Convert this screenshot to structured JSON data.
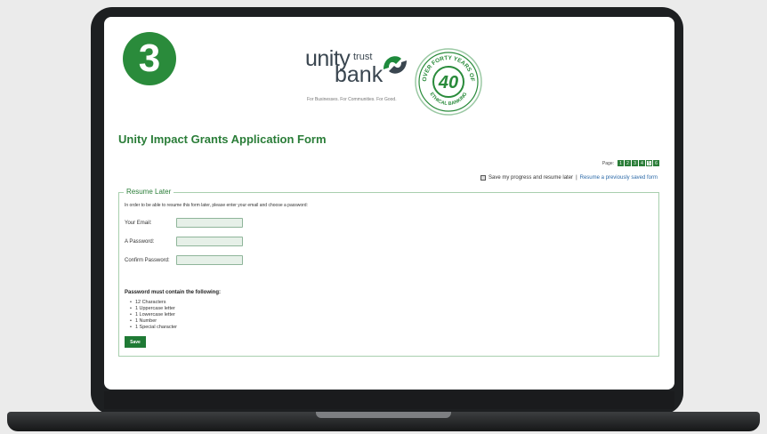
{
  "step": {
    "number": "3"
  },
  "logo": {
    "unity": "unity",
    "trust": "trust",
    "bank": "bank",
    "tagline": "For Businesses. For Communities. For Good.",
    "seal_top": "OVER FORTY YEARS OF",
    "seal_number": "40",
    "seal_bottom": "ETHICAL BANKING"
  },
  "page_title": "Unity Impact Grants Application Form",
  "pager": {
    "label": "Page:",
    "pages": [
      "1",
      "2",
      "3",
      "4",
      "5",
      "6"
    ],
    "current_page": "5"
  },
  "save_progress": {
    "checkbox_label": "Save my progress and resume later",
    "separator": "|",
    "resume_link": "Resume a previously saved form"
  },
  "resume_form": {
    "legend": "Resume Later",
    "instructions": "In order to be able to resume this form later, please enter your email and choose a password:",
    "email_label": "Your Email:",
    "password_label": "A Password:",
    "confirm_label": "Confirm Password:",
    "email_value": "",
    "password_value": "",
    "confirm_value": "",
    "password_rules_title": "Password must contain the following:",
    "password_rules": [
      "12 Characters",
      "1 Uppercase letter",
      "1 Lowercase letter",
      "1 Number",
      "1 Special character"
    ],
    "save_label": "Save"
  },
  "colors": {
    "brand_green": "#2a7d38",
    "badge_green": "#2a8b3b",
    "link_blue": "#2c6aa8"
  }
}
